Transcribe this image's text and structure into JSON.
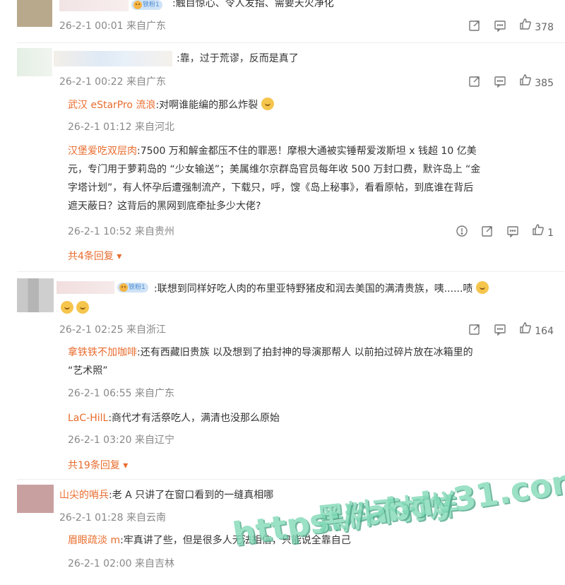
{
  "comments": [
    {
      "text": ":触目惊心、令人发指、需要天火净化",
      "meta": "26-2-1 00:01 来自广东",
      "likes": "378",
      "badge": "铁粉1"
    },
    {
      "text": ":靠，过于荒谬，反而是真了",
      "meta": "26-2-1 00:22 来自广东",
      "likes": "385",
      "replies": [
        {
          "name": "武汉 eStarPro 流浪",
          "text": ":对啊谁能编的那么炸裂",
          "meta": "26-2-1 01:12 来自河北"
        },
        {
          "name": "汉堡爱吃双层肉",
          "text_lines": [
            ":7500 万和解金都压不住的罪恶！摩根大通被实锤帮爱泼斯坦 x 钱超 10 亿美",
            "元，专门用于萝莉岛的 “少女输送”；美属维尔京群岛官员每年收 500 万封口费，默许岛上 “金",
            "字塔计划”，有人怀孕后遭强制流产，下载只，呼，馊《岛上秘事》，看看原帖，到底谁在背后",
            "遮天蔽日？这背后的黑网到底牵扯多少大佬?"
          ],
          "meta": "26-2-1 10:52 来自贵州",
          "likes": "1"
        }
      ],
      "more_replies": "共4条回复"
    },
    {
      "text": ":联想到同样好吃人肉的布里亚特野猪皮和润去美国的满清贵族，咦......啧",
      "meta": "26-2-1 02:25 来自浙江",
      "likes": "164",
      "badge": "铁粉1",
      "replies": [
        {
          "name": "拿铁铁不加咖啡",
          "text_lines": [
            ":还有西藏旧贵族 以及想到了拍封神的导演那帮人 以前拍过碎片放在冰箱里的",
            "“艺术照”"
          ],
          "meta": "26-2-1 06:55 来自广东"
        },
        {
          "name": "LaC-HilL",
          "text": ":商代才有活祭吃人，满清也没那么原始",
          "meta": "26-2-1 03:20 来自辽宁"
        }
      ],
      "more_replies": "共19条回复"
    },
    {
      "name": "山尖的哨兵",
      "text": ":老 A 只讲了在窗口看到的一缝真相哪",
      "meta": "26-2-1 01:28 来自云南",
      "replies": [
        {
          "name": "眉眼疏淡 m",
          "text": ":牢真讲了些，但是很多人无法相信，只能说全靠自己",
          "meta": "26-2-1 02:00 来自吉林"
        }
      ]
    }
  ],
  "watermark": {
    "line1": "黑料不打烊",
    "line2": "https://abdy31.com"
  },
  "colors": {
    "reply_name": "#e86c2e",
    "meta": "#888888",
    "watermark": "#7fd9b6"
  }
}
